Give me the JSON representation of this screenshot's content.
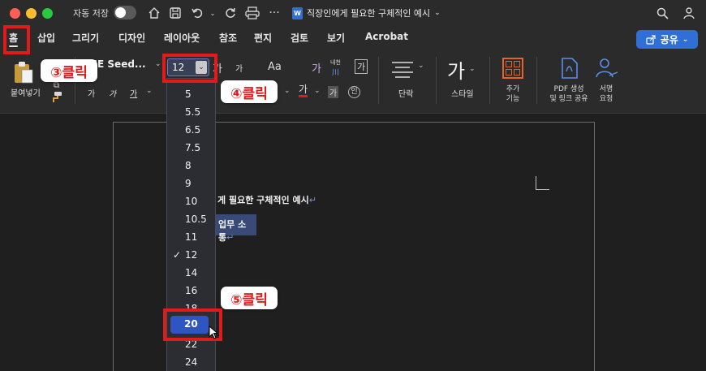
{
  "titlebar": {
    "autosave_label": "자동 저장",
    "doc_title": "직장인에게 필요한 구체적인 예시",
    "doc_icon_letter": "W"
  },
  "tabs": [
    {
      "label": "홈"
    },
    {
      "label": "삽입"
    },
    {
      "label": "그리기"
    },
    {
      "label": "디자인"
    },
    {
      "label": "레이아웃"
    },
    {
      "label": "참조"
    },
    {
      "label": "편지"
    },
    {
      "label": "검토"
    },
    {
      "label": "보기"
    },
    {
      "label": "Acrobat"
    }
  ],
  "share": {
    "label": "공유"
  },
  "ribbon": {
    "paste_label": "붙여넣기",
    "font_name": "NE Seed...",
    "font_size": "12",
    "bold_glyph": "가",
    "italic_glyph": "가",
    "underline_glyph": "가",
    "grow_glyph": "가",
    "shrink_glyph": "가",
    "case_glyph": "Aa",
    "highlight_glyph": "가",
    "phonetic_top": "내천",
    "phonetic_bottom": "川",
    "border_glyph": "가",
    "font_color_glyph": "가",
    "shading_glyph": "가",
    "enclosed_glyph": "인",
    "paragraph_label": "단락",
    "style_glyph": "가",
    "style_label": "스타일",
    "addins_line1": "추가",
    "addins_line2": "기능",
    "pdf_line1": "PDF 생성",
    "pdf_line2": "및 링크 공유",
    "sign_line1": "서명",
    "sign_line2": "요청"
  },
  "document": {
    "line1": "게 필요한 구체적인 예시",
    "line2": "업무 소통"
  },
  "dropdown": {
    "sizes": [
      "5",
      "5.5",
      "6.5",
      "7.5",
      "8",
      "9",
      "10",
      "10.5",
      "11",
      "12",
      "14",
      "16",
      "18",
      "20",
      "22",
      "24"
    ],
    "checked": "12",
    "selected": "20",
    "checkmark": "✓"
  },
  "callouts": {
    "step3": "③클릭",
    "step4": "④클릭",
    "step5": "⑤클릭"
  },
  "colors": {
    "accent_blue": "#2f6fd6",
    "annotation_red": "#e11b1b",
    "selection_blue": "#2f55c2"
  }
}
